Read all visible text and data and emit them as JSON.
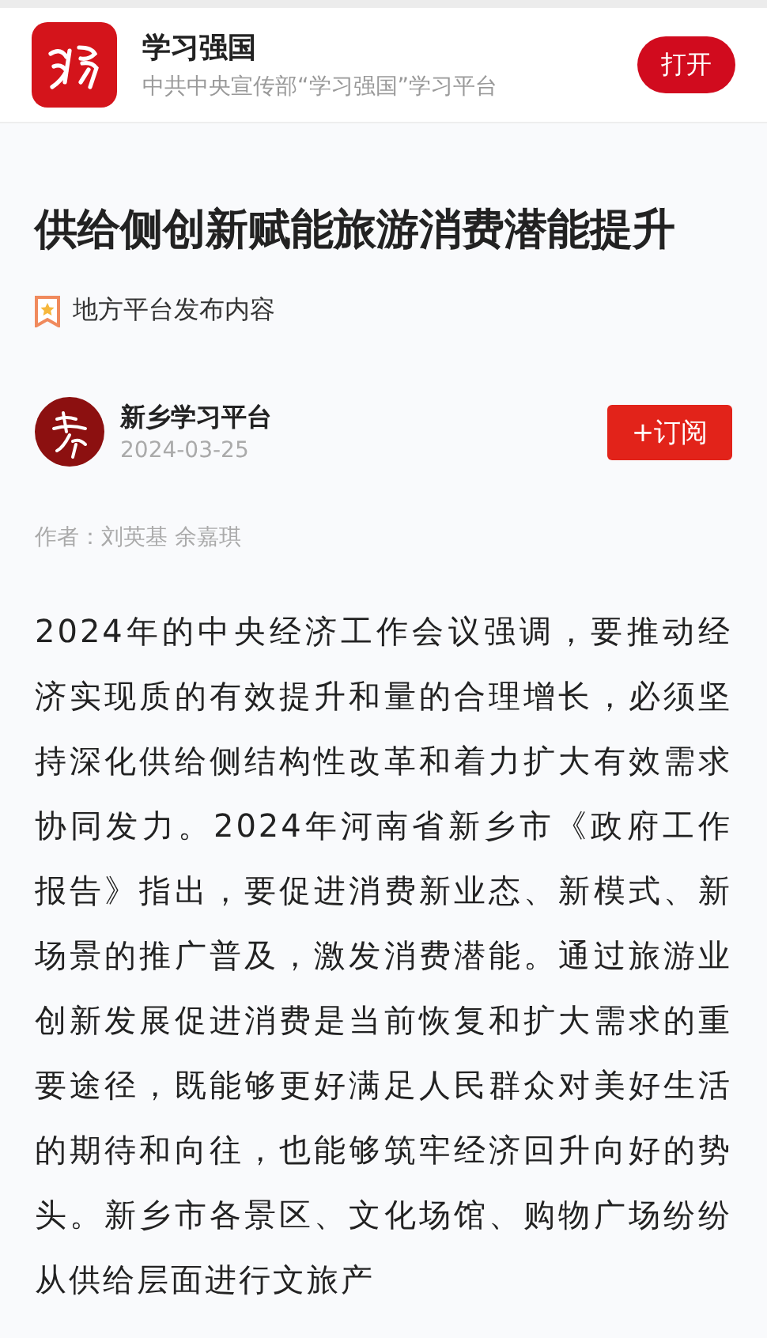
{
  "app_banner": {
    "app_name": "学习强国",
    "tagline": "中共中央宣传部“学习强国”学习平台",
    "open_button": "打开"
  },
  "article": {
    "title": "供给侧创新赋能旅游消费潜能提升",
    "source_tag": "地方平台发布内容",
    "publisher": {
      "name": "新乡学习平台",
      "date": "2024-03-25",
      "subscribe_button": "+订阅"
    },
    "author": "作者：刘英基 余嘉琪",
    "body": "2024年的中央经济工作会议强调，要推动经济实现质的有效提升和量的合理增长，必须坚持深化供给侧结构性改革和着力扩大有效需求协同发力。2024年河南省新乡市《政府工作报告》指出，要促进消费新业态、新模式、新场景的推广普及，激发消费潜能。通过旅游业创新发展促进消费是当前恢复和扩大需求的重要途径，既能够更好满足人民群众对美好生活的期待和向往，也能够筑牢经济回升向好的势头。新乡市各景区、文化场馆、购物广场纷纷从供给层面进行文旅产"
  }
}
